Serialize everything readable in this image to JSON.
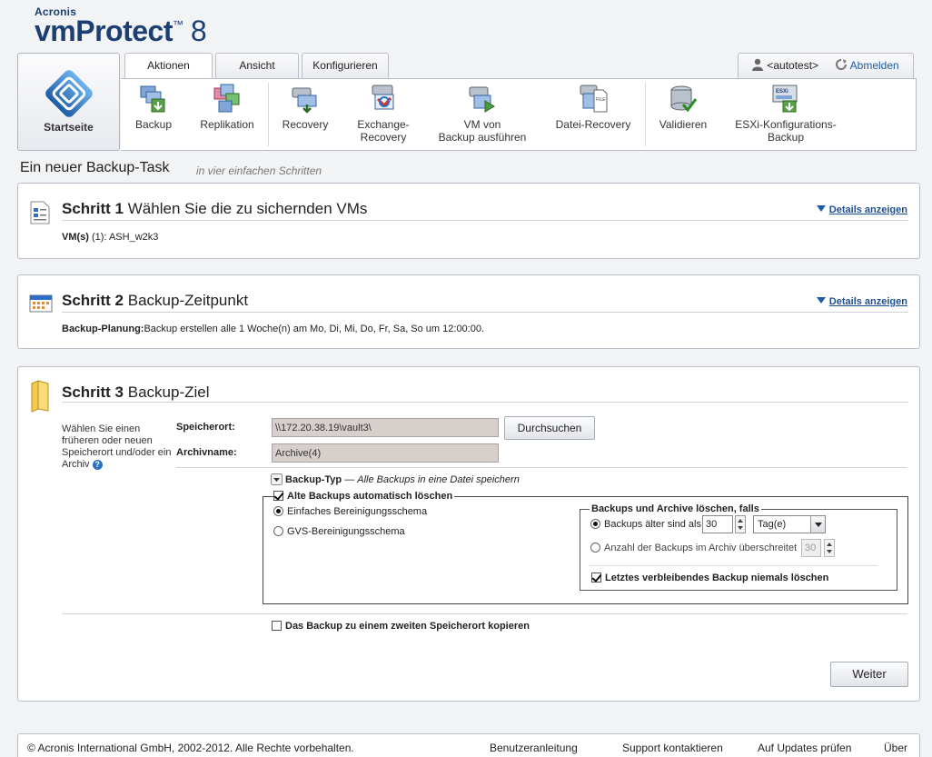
{
  "app": {
    "brand": "Acronis",
    "product": "vmProtect",
    "version": "8"
  },
  "start_tile": {
    "label": "Startseite"
  },
  "tabs": [
    {
      "label": "Aktionen",
      "active": true
    },
    {
      "label": "Ansicht",
      "active": false
    },
    {
      "label": "Konfigurieren",
      "active": false
    }
  ],
  "ribbon": [
    {
      "id": "backup",
      "label": "Backup"
    },
    {
      "id": "replication",
      "label": "Replikation"
    },
    {
      "id": "recovery",
      "label": "Recovery"
    },
    {
      "id": "exchange",
      "label1": "Exchange-",
      "label2": "Recovery"
    },
    {
      "id": "vm-run",
      "label1": "VM von",
      "label2": "Backup ausführen"
    },
    {
      "id": "file-recovery",
      "label": "Datei-Recovery"
    },
    {
      "id": "validate",
      "label": "Validieren"
    },
    {
      "id": "esxi",
      "label1": "ESXi-Konfigurations-",
      "label2": "Backup"
    }
  ],
  "userbar": {
    "user": "<autotest>",
    "logout": "Abmelden"
  },
  "page": {
    "title": "Ein neuer Backup-Task",
    "subtitle": "in vier einfachen Schritten"
  },
  "step1": {
    "number": "Schritt 1",
    "title": "Wählen Sie die zu sichernden VMs",
    "details": "Details anzeigen",
    "label": "VM(s)",
    "value": "(1): ASH_w2k3"
  },
  "step2": {
    "number": "Schritt 2",
    "title": "Backup-Zeitpunkt",
    "details": "Details anzeigen",
    "label": "Backup-Planung:",
    "value": "Backup erstellen alle 1 Woche(n) am Mo, Di, Mi, Do, Fr, Sa, So um 12:00:00."
  },
  "step3": {
    "number": "Schritt 3",
    "title": "Backup-Ziel",
    "hint": "Wählen Sie einen früheren oder neuen Speicherort und/oder ein Archiv",
    "location_label": "Speicherort:",
    "location_value": "\\\\172.20.38.19\\vault3\\",
    "browse": "Durchsuchen",
    "archive_label": "Archivname:",
    "archive_value": "Archive(4)",
    "backup_type_label": "Backup-Typ",
    "backup_type_dash": "—",
    "backup_type_value": "Alle Backups in eine Datei speichern",
    "auto_delete_label": "Alte Backups automatisch löschen",
    "scheme_simple": "Einfaches Bereinigungsschema",
    "scheme_gvs": "GVS-Bereinigungsschema",
    "cleanup_group_title": "Backups und Archive löschen, falls",
    "older_than_label": "Backups älter sind als",
    "older_than_value": "30",
    "unit_value": "Tag(e)",
    "count_label": "Anzahl der Backups im Archiv überschreitet",
    "count_value": "30",
    "keep_last_label": "Letztes verbleibendes Backup niemals löschen",
    "copy_label": "Das Backup zu einem zweiten Speicherort kopieren",
    "next": "Weiter"
  },
  "footer": {
    "copyright": "© Acronis International GmbH, 2002-2012. Alle Rechte vorbehalten.",
    "links": [
      "Benutzeranleitung",
      "Support kontaktieren",
      "Auf Updates prüfen",
      "Über"
    ]
  },
  "colors": {
    "brand_blue": "#1b3f73",
    "link_blue": "#1d4f93",
    "input_bg": "#d6cfcc"
  }
}
